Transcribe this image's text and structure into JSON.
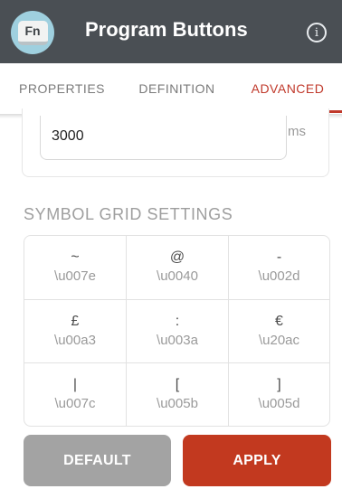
{
  "appbar": {
    "icon_label": "Fn",
    "title": "Program Buttons",
    "info_icon": "info-icon"
  },
  "tabs": [
    {
      "label": "PROPERTIES",
      "active": false
    },
    {
      "label": "DEFINITION",
      "active": false
    },
    {
      "label": "ADVANCED",
      "active": true
    }
  ],
  "timeout": {
    "value": "3000",
    "unit": "ms"
  },
  "symbol_grid": {
    "title": "SYMBOL GRID SETTINGS",
    "cells": [
      {
        "symbol": "~",
        "code": "\\u007e"
      },
      {
        "symbol": "@",
        "code": "\\u0040"
      },
      {
        "symbol": "-",
        "code": "\\u002d"
      },
      {
        "symbol": "£",
        "code": "\\u00a3"
      },
      {
        "symbol": ":",
        "code": "\\u003a"
      },
      {
        "symbol": "€",
        "code": "\\u20ac"
      },
      {
        "symbol": "|",
        "code": "\\u007c"
      },
      {
        "symbol": "[",
        "code": "\\u005b"
      },
      {
        "symbol": "]",
        "code": "\\u005d"
      }
    ]
  },
  "buttons": {
    "default_label": "DEFAULT",
    "apply_label": "APPLY"
  },
  "colors": {
    "appbar": "#4a4f54",
    "accent": "#c0392b",
    "apply": "#c2391f",
    "default": "#a3a3a3"
  }
}
